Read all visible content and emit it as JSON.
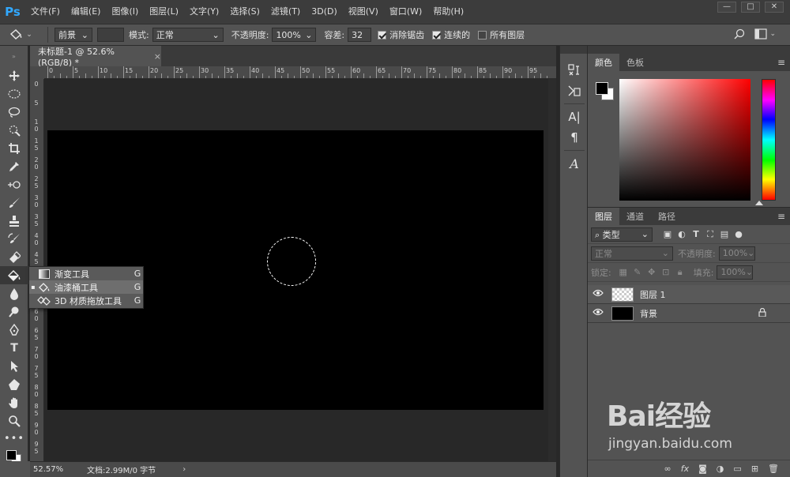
{
  "app": {
    "logo": "Ps"
  },
  "menu": [
    "文件(F)",
    "编辑(E)",
    "图像(I)",
    "图层(L)",
    "文字(Y)",
    "选择(S)",
    "滤镜(T)",
    "3D(D)",
    "视图(V)",
    "窗口(W)",
    "帮助(H)"
  ],
  "window_controls": {
    "minimize": "—",
    "maximize": "□",
    "close": "✕"
  },
  "options": {
    "fill_source": "前景",
    "mode_label": "模式:",
    "mode_value": "正常",
    "opacity_label": "不透明度:",
    "opacity_value": "100%",
    "tolerance_label": "容差:",
    "tolerance_value": "32",
    "antialias_label": "消除锯齿",
    "antialias_checked": true,
    "contiguous_label": "连续的",
    "contiguous_checked": true,
    "all_layers_label": "所有图层",
    "all_layers_checked": false
  },
  "document": {
    "tab_title": "未标题-1 @ 52.6%(RGB/8) *",
    "tab_close": "×",
    "ruler_h": [
      "0",
      "5",
      "10",
      "15",
      "20",
      "25",
      "30",
      "35",
      "40",
      "45",
      "50",
      "55",
      "60",
      "65",
      "70",
      "75",
      "80",
      "85",
      "90",
      "95"
    ],
    "ruler_v": [
      "0",
      "5",
      "1 0",
      "1 5",
      "2 0",
      "2 5",
      "3 0",
      "3 5",
      "4 0",
      "4 5",
      "5 0",
      "5 5",
      "6 0",
      "6 5",
      "7 0",
      "7 5",
      "8 0",
      "8 5",
      "9 0",
      "9 5"
    ],
    "canvas_color": "#000000"
  },
  "status": {
    "zoom": "52.57%",
    "doc_info": "文档:2.99M/0 字节",
    "arrow": "›"
  },
  "flyout": [
    {
      "label": "渐变工具",
      "key": "G",
      "active": false,
      "bullet": ""
    },
    {
      "label": "油漆桶工具",
      "key": "G",
      "active": true,
      "bullet": "▪"
    },
    {
      "label": "3D 材质拖放工具",
      "key": "G",
      "active": false,
      "bullet": ""
    }
  ],
  "color_panel": {
    "tabs": [
      "颜色",
      "色板"
    ],
    "fg": "#000000",
    "bg": "#ffffff"
  },
  "layers_panel": {
    "tabs": [
      "图层",
      "通道",
      "路径"
    ],
    "filter_label": "类型",
    "blend_mode": "正常",
    "opacity_label": "不透明度:",
    "opacity_value": "100%",
    "lock_label": "锁定:",
    "fill_label": "填充:",
    "fill_value": "100%",
    "layers": [
      {
        "name": "图层 1",
        "thumb": "transparent",
        "locked": false
      },
      {
        "name": "背景",
        "thumb": "black",
        "locked": true
      }
    ],
    "bottom_icons": [
      "link-icon",
      "fx-icon",
      "mask-icon",
      "adjustment-icon",
      "group-icon",
      "new-layer-icon",
      "trash-icon"
    ],
    "fx_label": "fx"
  },
  "watermark": {
    "brand": "Bai经验",
    "url": "jingyan.baidu.com"
  }
}
